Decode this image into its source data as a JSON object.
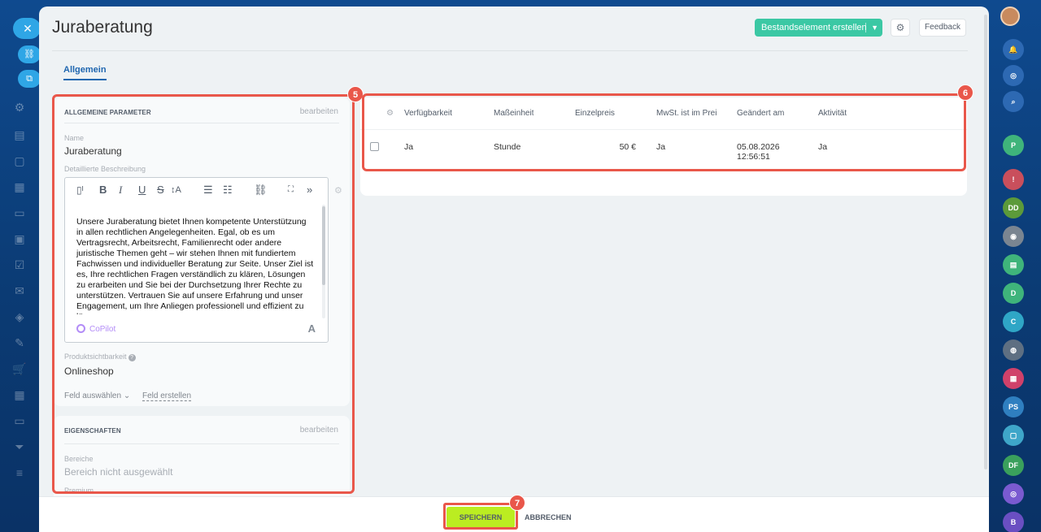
{
  "window": {
    "title": "Juraberatung"
  },
  "header": {
    "create_button": "Bestandselement erstellen",
    "settings_icon": "gear-icon",
    "feedback_button": "Feedback"
  },
  "tabs": [
    {
      "label": "Allgemein",
      "active": true
    }
  ],
  "general": {
    "title": "ALLGEMEINE PARAMETER",
    "edit": "bearbeiten",
    "name_label": "Name",
    "name_value": "Juraberatung",
    "description_label": "Detaillierte Beschreibung",
    "description_text": "Unsere Juraberatung bietet Ihnen kompetente Unterstützung in allen rechtlichen Angelegenheiten. Egal, ob es um Vertragsrecht, Arbeitsrecht, Familienrecht oder andere juristische Themen geht – wir stehen Ihnen mit fundiertem Fachwissen und individueller Beratung zur Seite. Unser Ziel ist es, Ihre rechtlichen Fragen verständlich zu klären, Lösungen zu erarbeiten und Sie bei der Durchsetzung Ihrer Rechte zu unterstützen. Vertrauen Sie auf unsere Erfahrung und unser Engagement, um Ihre Anliegen professionell und effizient zu lösen.",
    "copilot": "CoPilot",
    "font_button": "A",
    "visibility_label": "Produktsichtbarkeit",
    "visibility_value": "Onlineshop",
    "field_select": "Feld auswählen",
    "field_create": "Feld erstellen"
  },
  "properties": {
    "title": "EIGENSCHAFTEN",
    "edit": "bearbeiten",
    "areas_label": "Bereiche",
    "areas_value": "Bereich nicht ausgewählt",
    "premium_label": "Premium"
  },
  "table": {
    "columns": [
      "Verfügbarkeit",
      "Maßeinheit",
      "Einzelpreis",
      "MwSt. ist im Preis",
      "Geändert am",
      "Aktivität"
    ],
    "rows": [
      {
        "availability": "Ja",
        "unit": "Stunde",
        "price": "50 €",
        "vat_included": "Ja",
        "changed_date": "05.08.2026",
        "changed_time": "12:56:51",
        "active": "Ja"
      }
    ]
  },
  "badges": {
    "left": "5",
    "right": "6",
    "save": "7"
  },
  "footer": {
    "save": "SPEICHERN",
    "cancel": "ABBRECHEN"
  },
  "colors": {
    "accent": "#2067b0",
    "create_button": "#3bc8a4",
    "save_button": "#bbed21",
    "highlight": "#e9574a"
  }
}
